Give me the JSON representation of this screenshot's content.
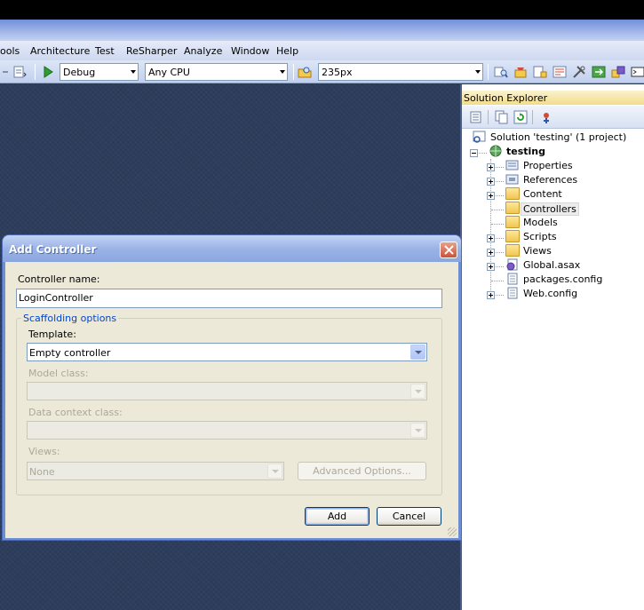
{
  "menu": [
    "ools",
    "Architecture",
    "Test",
    "ReSharper",
    "Analyze",
    "Window",
    "Help"
  ],
  "toolbar": {
    "configuration": "Debug",
    "platform": "Any CPU",
    "find": "235px"
  },
  "solution_explorer": {
    "title": "Solution Explorer",
    "solution": "Solution 'testing' (1 project)",
    "project": "testing",
    "items": [
      "Properties",
      "References",
      "Content",
      "Controllers",
      "Models",
      "Scripts",
      "Views",
      "Global.asax",
      "packages.config",
      "Web.config"
    ],
    "selected": "Controllers"
  },
  "dialog": {
    "title": "Add Controller",
    "controller_name_label": "Controller name:",
    "controller_name_value": "LoginController",
    "scaffolding_legend": "Scaffolding options",
    "template_label": "Template:",
    "template_value": "Empty controller",
    "model_class_label": "Model class:",
    "data_context_label": "Data context class:",
    "views_label": "Views:",
    "views_value": "None",
    "advanced_options": "Advanced Options...",
    "add": "Add",
    "cancel": "Cancel"
  }
}
